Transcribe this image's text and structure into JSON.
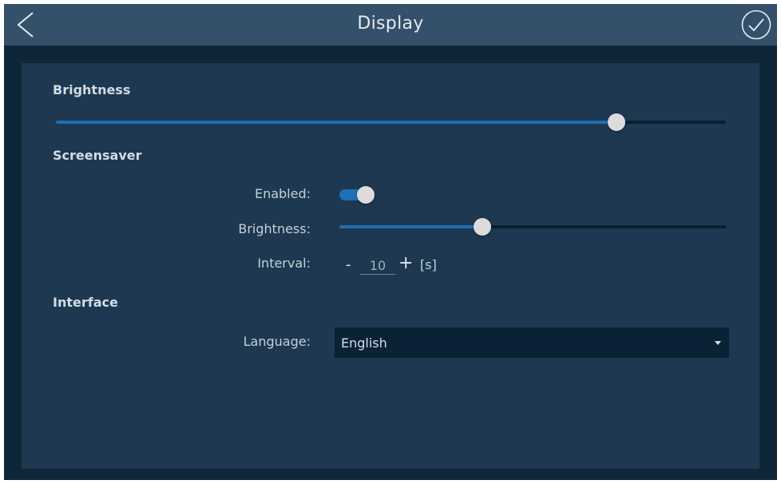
{
  "header": {
    "title": "Display",
    "back_icon": "chevron-left-icon",
    "confirm_icon": "check-circle-icon"
  },
  "brightness": {
    "heading": "Brightness",
    "value_fraction": 0.837
  },
  "screensaver": {
    "heading": "Screensaver",
    "enabled_label": "Enabled:",
    "enabled": true,
    "brightness_label": "Brightness:",
    "brightness_fraction": 0.37,
    "interval_label": "Interval:",
    "interval_value": "10",
    "decrement_label": "-",
    "increment_label": "+",
    "interval_unit": "[s]"
  },
  "interface": {
    "heading": "Interface",
    "language_label": "Language:",
    "language_value": "English",
    "dropdown_icon": "caret-down-icon"
  },
  "colors": {
    "accent": "#1f6fb4",
    "header_bg": "#34506a",
    "panel_bg": "#1d3850",
    "frame_bg": "#0f2638"
  }
}
